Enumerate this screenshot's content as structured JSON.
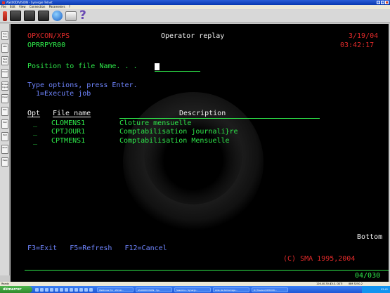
{
  "window": {
    "title": "AS400DIVISION - Synergie Telnet",
    "menu": [
      "File",
      "Edit",
      "View",
      "Connection",
      "Parameters",
      "?"
    ]
  },
  "toolbar": {
    "help_glyph": "?"
  },
  "side_buttons": [
    "Sys Req",
    "Attn",
    "Test Req",
    "Clear",
    "Erase Input",
    "Clear",
    "PA1",
    "PA2",
    "PA3",
    "Print",
    "Help"
  ],
  "terminal": {
    "system": "OPXCON/XPS",
    "program": "OPRRPYR00",
    "title": "Operator replay",
    "date": "3/19/04",
    "time": "03:42:17",
    "position_prompt": "Position to file Name. . .",
    "instructions": "Type options, press Enter.",
    "option_1": "1=Execute job",
    "headers": {
      "opt": "Opt",
      "file_name": "File name",
      "description": "Description"
    },
    "rows": [
      {
        "opt": "_",
        "file": "CLOMENS1",
        "description": "Cloture mensuelle"
      },
      {
        "opt": "_",
        "file": "CPTJOUR1",
        "description": "Comptabilisation journali}re"
      },
      {
        "opt": "_",
        "file": "CPTMENS1",
        "description": "Comptabilisation Mensuelle"
      }
    ],
    "bottom_indicator": "Bottom",
    "function_keys": "F3=Exit   F5=Refresh   F12=Cancel",
    "copyright": "(C) SMA 1995,2004",
    "cursor_position": "04/030"
  },
  "status_bar": {
    "left": "Ready",
    "position": "126.40.30.4",
    "session": "OI.S. DSTI",
    "system": "IBM 5250-2"
  },
  "taskbar": {
    "start_label": "démarrer",
    "tasks": [
      "Wellknow Pro - Windo...",
      "AS400DIVISION - Sy...",
      "Sessions - Synergi...",
      "Aide de démarrage...",
      "D:\\Travaux\\OPXCON..."
    ],
    "clock": "03:42"
  },
  "colors": {
    "terminal_bg": "#000000",
    "green": "#2ee84a",
    "red": "#e02a2a",
    "white": "#f2f2f2",
    "blue": "#6f85ff"
  }
}
